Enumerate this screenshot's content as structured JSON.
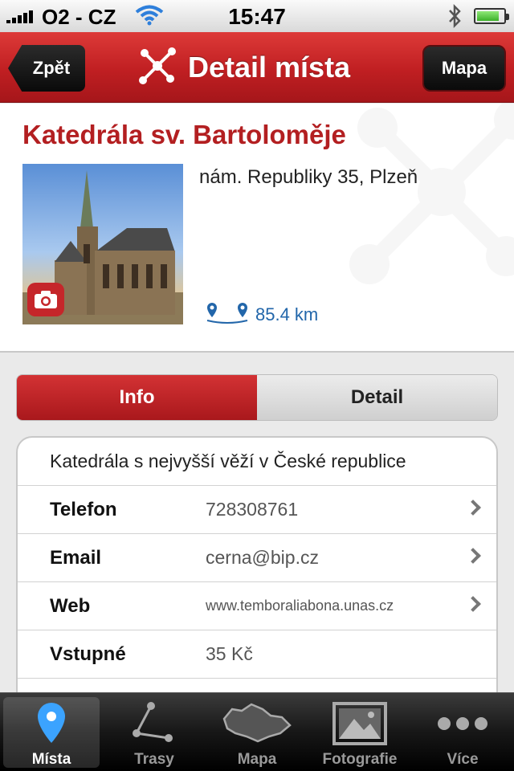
{
  "status": {
    "carrier": "O2 - CZ",
    "time": "15:47"
  },
  "nav": {
    "back_label": "Zpět",
    "title": "Detail místa",
    "map_label": "Mapa"
  },
  "place": {
    "title": "Katedrála sv. Bartoloměje",
    "address": "nám. Republiky 35, Plzeň",
    "distance": "85.4 km"
  },
  "segments": {
    "info": "Info",
    "detail": "Detail"
  },
  "info": {
    "description": "Katedrála s nejvyšší věží v České republice",
    "rows": [
      {
        "label": "Telefon",
        "value": "728308761"
      },
      {
        "label": "Email",
        "value": "cerna@bip.cz"
      },
      {
        "label": "Web",
        "value": "www.temboraliabona.unas.cz"
      },
      {
        "label": "Vstupné",
        "value": "35 Kč"
      }
    ]
  },
  "tabs": [
    {
      "label": "Místa",
      "icon": "map-pin-icon"
    },
    {
      "label": "Trasy",
      "icon": "route-icon"
    },
    {
      "label": "Mapa",
      "icon": "czech-map-icon"
    },
    {
      "label": "Fotografie",
      "icon": "photo-icon"
    },
    {
      "label": "Více",
      "icon": "more-icon"
    }
  ],
  "colors": {
    "accent": "#c01f22",
    "link": "#2266aa"
  }
}
